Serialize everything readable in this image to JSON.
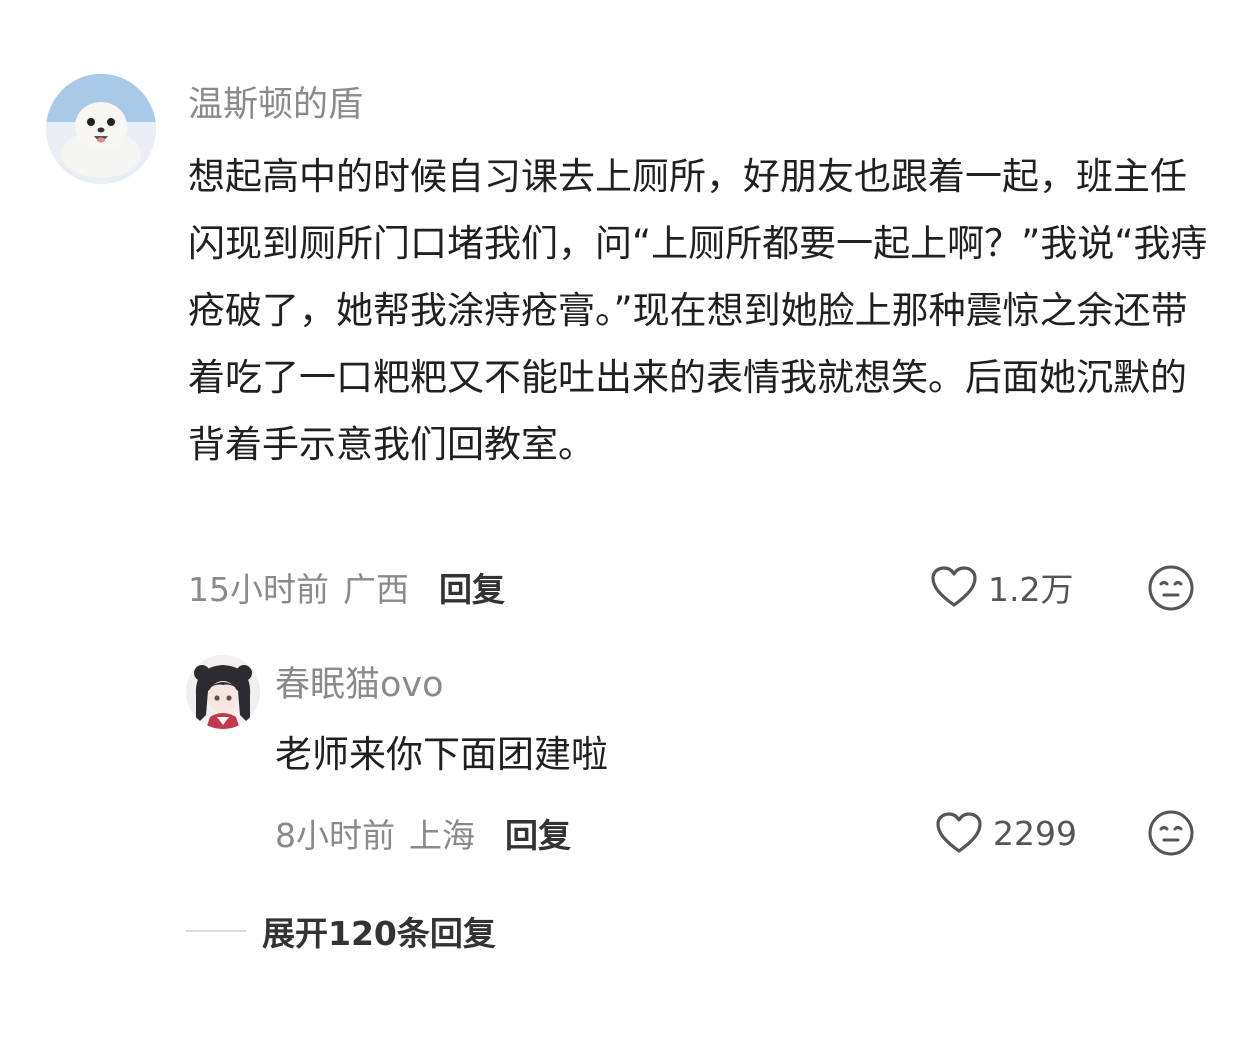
{
  "main_comment": {
    "username": "温斯顿的盾",
    "text": "想起高中的时候自习课去上厕所，好朋友也跟着一起，班主任闪现到厕所门口堵我们，问“上厕所都要一起上啊？”我说“我痔疮破了，她帮我涂痔疮膏。”现在想到她脸上那种震惊之余还带着吃了一口粑粑又不能吐出来的表情我就想笑。后面她沉默的背着手示意我们回教室。",
    "time": "15小时前",
    "location": "广西",
    "reply_label": "回复",
    "like_count": "1.2万",
    "avatar_icon": "seal-avatar"
  },
  "reply_comment": {
    "username": "春眠猫ovo",
    "text": "老师来你下面团建啦",
    "time": "8小时前",
    "location": "上海",
    "reply_label": "回复",
    "like_count": "2299",
    "avatar_icon": "anime-girl-avatar"
  },
  "expand": {
    "label": "展开120条回复"
  },
  "colors": {
    "secondary_text": "#8a8a8a",
    "primary_text": "#202020",
    "icon_gray": "#555555"
  }
}
